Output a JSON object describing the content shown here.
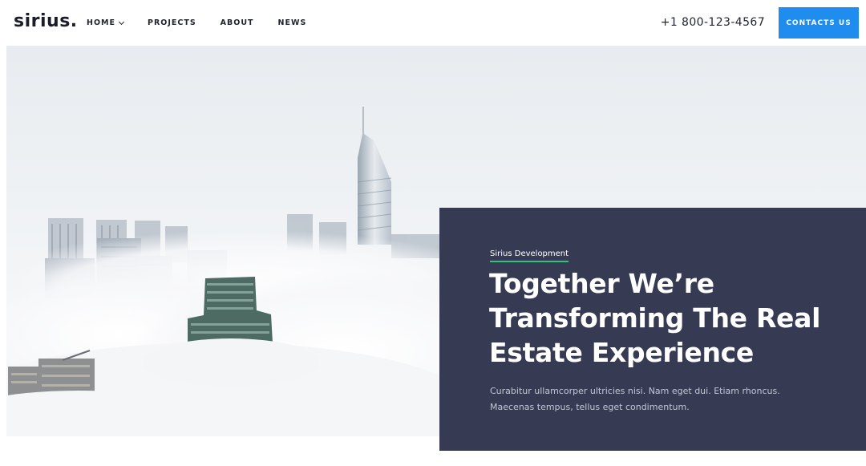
{
  "header": {
    "logo": "sirius.",
    "nav": [
      {
        "label": "HOME",
        "has_dropdown": true
      },
      {
        "label": "PROJECTS"
      },
      {
        "label": "ABOUT"
      },
      {
        "label": "NEWS"
      }
    ],
    "phone": "+1 800-123-4567",
    "cta_label": "CONTACTS US"
  },
  "hero": {
    "image": "city-skyline-above-clouds",
    "eyebrow": "Sirius Development",
    "headline": "Together We’re Transforming The Real Estate Experience",
    "description_line1": "Curabitur ullamcorper ultricies nisi. Nam eget dui. Etiam rhoncus.",
    "description_line2": "Maecenas tempus, tellus eget condimentum."
  },
  "colors": {
    "accent": "#1f8cef",
    "panel": "#363a53",
    "underline": "#2ec27e"
  }
}
